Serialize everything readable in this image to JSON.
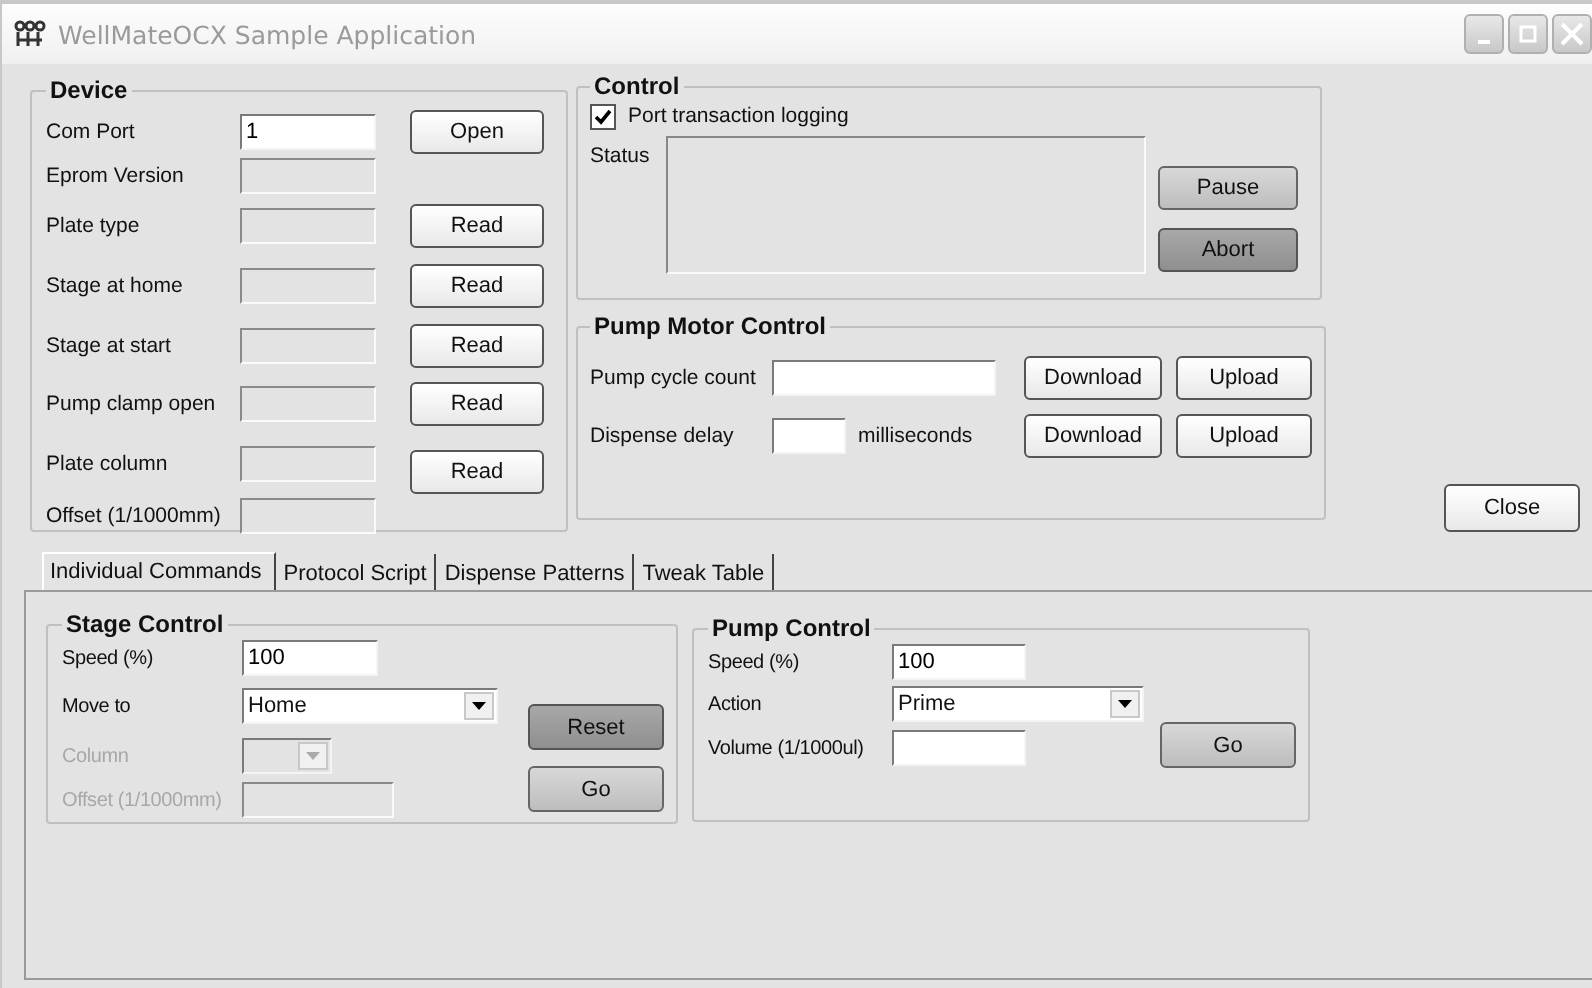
{
  "window": {
    "title": "WellMateOCX Sample Application"
  },
  "device": {
    "title": "Device",
    "rows": [
      {
        "label": "Com Port",
        "value": "1",
        "disabled": false,
        "button": "Open"
      },
      {
        "label": "Eprom Version",
        "disabled": true
      },
      {
        "label": "Plate type",
        "disabled": true,
        "button": "Read"
      },
      {
        "label": "Stage at home",
        "disabled": true,
        "button": "Read"
      },
      {
        "label": "Stage at start",
        "disabled": true,
        "button": "Read"
      },
      {
        "label": "Pump clamp open",
        "disabled": true,
        "button": "Read"
      },
      {
        "label": "Plate column",
        "disabled": true,
        "button": "Read"
      },
      {
        "label": "Offset (1/1000mm)",
        "disabled": true
      }
    ]
  },
  "control": {
    "title": "Control",
    "logging": {
      "label": "Port transaction logging",
      "checked": true
    },
    "status_label": "Status",
    "buttons": [
      {
        "label": "Pause",
        "kind": "light"
      },
      {
        "label": "Abort",
        "kind": "dark"
      }
    ]
  },
  "pump_motor": {
    "title": "Pump Motor Control",
    "rows": [
      {
        "label": "Pump cycle count",
        "kind": "wide",
        "buttons": [
          "Download",
          "Upload"
        ]
      },
      {
        "label": "Dispense delay",
        "kind": "narrow",
        "unit": "milliseconds",
        "buttons": [
          "Download",
          "Upload"
        ]
      }
    ]
  },
  "close_button": "Close",
  "tabs": [
    {
      "label": "Individual Commands",
      "selected": true
    },
    {
      "label": "Protocol Script",
      "selected": false
    },
    {
      "label": "Dispense Patterns",
      "selected": false
    },
    {
      "label": "Tweak Table",
      "selected": false
    }
  ],
  "stage_control": {
    "title": "Stage Control",
    "rows": [
      {
        "kind": "text",
        "label": "Speed (%)",
        "value": "100",
        "disabled": false
      },
      {
        "kind": "dropdown",
        "label": "Move to",
        "value": "Home",
        "disabled": false
      },
      {
        "kind": "dropdown",
        "label": "Column",
        "disabled": true
      },
      {
        "kind": "text",
        "label": "Offset (1/1000mm)",
        "disabled": true
      }
    ],
    "buttons": [
      {
        "label": "Reset",
        "kind": "dark"
      },
      {
        "label": "Go",
        "kind": "light"
      }
    ]
  },
  "pump_control": {
    "title": "Pump Control",
    "rows": [
      {
        "kind": "text",
        "label": "Speed (%)",
        "value": "100"
      },
      {
        "kind": "dropdown",
        "label": "Action",
        "value": "Prime"
      },
      {
        "kind": "text",
        "label": "Volume (1/1000ul)"
      }
    ],
    "buttons": [
      {
        "label": "Go",
        "kind": "light"
      }
    ]
  }
}
